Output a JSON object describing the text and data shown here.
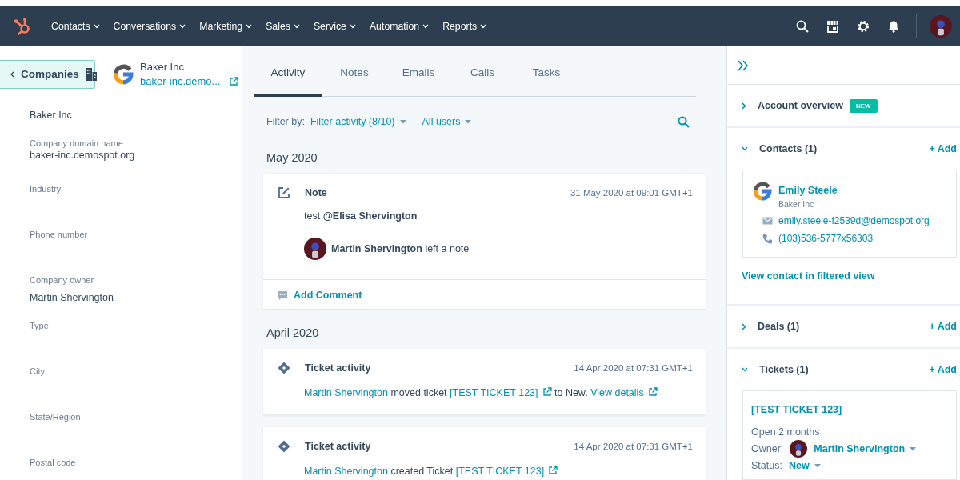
{
  "nav": {
    "items": [
      {
        "label": "Contacts"
      },
      {
        "label": "Conversations"
      },
      {
        "label": "Marketing"
      },
      {
        "label": "Sales"
      },
      {
        "label": "Service"
      },
      {
        "label": "Automation"
      },
      {
        "label": "Reports"
      }
    ]
  },
  "record": {
    "back_button": {
      "label": "Companies"
    },
    "name": "Baker Inc",
    "domain_link": "baker-inc.demo...",
    "properties": [
      {
        "value": "Baker Inc"
      },
      {
        "label": "Company domain name",
        "value": "baker-inc.demospot.org"
      },
      {
        "label": "Industry"
      },
      {
        "label": "Phone number"
      },
      {
        "label": "Company owner",
        "value": "Martin Shervington"
      },
      {
        "label": "Type"
      },
      {
        "label": "City"
      },
      {
        "label": "State/Region"
      },
      {
        "label": "Postal code"
      }
    ]
  },
  "tabs": [
    {
      "label": "Activity",
      "selected": true
    },
    {
      "label": "Notes",
      "selected": false
    },
    {
      "label": "Emails",
      "selected": false
    },
    {
      "label": "Calls",
      "selected": false
    },
    {
      "label": "Tasks",
      "selected": false
    }
  ],
  "filter": {
    "label": "Filter by:",
    "activity": "Filter activity (8/10)",
    "users": "All users"
  },
  "groups": [
    {
      "month": "May 2020",
      "items": [
        {
          "kind": "note",
          "title": "Note",
          "timestamp": "31 May 2020 at 09:01 GMT+1",
          "body": "test **@Elisa Shervington**",
          "author_line": "**Martin Shervington** left a note",
          "comment": "Add Comment"
        }
      ]
    },
    {
      "month": "April 2020",
      "items": [
        {
          "kind": "ticket",
          "title": "Ticket activity",
          "timestamp": "14 Apr 2020 at 07:31 GMT+1",
          "parts": [
            {
              "kind": "link",
              "text": "Martin Shervington",
              "external": false
            },
            {
              "kind": "text",
              "text": " moved ticket "
            },
            {
              "kind": "link",
              "text": "[TEST TICKET 123]",
              "external": true
            },
            {
              "kind": "text",
              "text": " to New. "
            },
            {
              "kind": "link",
              "text": "View details",
              "external": true
            }
          ]
        },
        {
          "kind": "ticket",
          "title": "Ticket activity",
          "timestamp": "14 Apr 2020 at 07:31 GMT+1",
          "parts": [
            {
              "kind": "link",
              "text": "Martin Shervington",
              "external": false
            },
            {
              "kind": "text",
              "text": " created Ticket "
            },
            {
              "kind": "link",
              "text": "[TEST TICKET 123]",
              "external": true
            }
          ]
        }
      ]
    }
  ],
  "sidebar": {
    "sections": [
      {
        "title": "Account overview",
        "badge": "NEW",
        "expanded": false
      },
      {
        "kind": "contacts",
        "title": "Contacts (1)",
        "add": "+ Add",
        "expanded": true,
        "contact": {
          "name": "Emily Steele",
          "company": "Baker Inc",
          "email": "emily.steele-f2539d@demospot.org",
          "phone": "(103)536-5777x56303"
        },
        "link": "View contact in filtered view"
      },
      {
        "title": "Deals (1)",
        "add": "+ Add",
        "expanded": false
      },
      {
        "kind": "tickets",
        "title": "Tickets (1)",
        "add": "+ Add",
        "expanded": true,
        "ticket": {
          "title": "[TEST TICKET 123]",
          "age": "Open 2 months",
          "owner_label": "Owner:",
          "owner": "Martin Shervington",
          "status_label": "Status:",
          "status": "New"
        }
      }
    ]
  }
}
